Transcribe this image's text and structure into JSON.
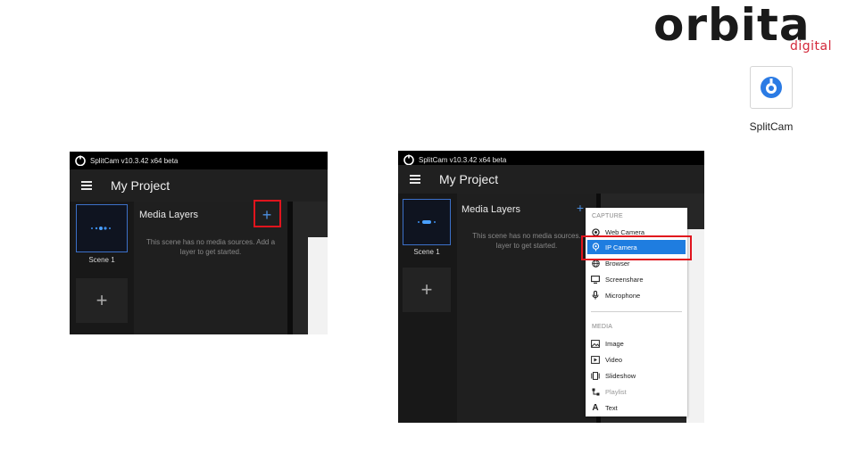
{
  "brand": {
    "name": "orbita",
    "sub": "digital",
    "accent_color": "#d3283a"
  },
  "desktop_icon": {
    "label": "SplitCam",
    "icon": "splitcam-icon"
  },
  "left_screenshot": {
    "window_title": "SplitCam v10.3.42 x64 beta",
    "project_title": "My Project",
    "scene_label": "Scene 1",
    "layers_title": "Media Layers",
    "empty_message_1": "This scene has no media sources. Add a",
    "empty_message_2": "layer to get started.",
    "add_layer_symbol": "+",
    "add_scene_symbol": "+"
  },
  "right_screenshot": {
    "window_title": "SplitCam v10.3.42 x64 beta",
    "project_title": "My Project",
    "scene_label": "Scene 1",
    "layers_title": "Media Layers",
    "empty_message_1": "This scene has no media sources.",
    "empty_message_2": "layer to get started.",
    "add_layer_symbol": "+",
    "add_scene_symbol": "+",
    "menu": {
      "capture_header": "CAPTURE",
      "capture_items": [
        {
          "label": "Web Camera",
          "icon": "webcam-icon"
        },
        {
          "label": "IP Camera",
          "icon": "ip-camera-icon",
          "active": true
        },
        {
          "label": "Browser",
          "icon": "globe-icon"
        },
        {
          "label": "Screenshare",
          "icon": "monitor-icon"
        },
        {
          "label": "Microphone",
          "icon": "microphone-icon"
        }
      ],
      "media_header": "MEDIA",
      "media_items": [
        {
          "label": "Image",
          "icon": "image-icon"
        },
        {
          "label": "Video",
          "icon": "video-icon"
        },
        {
          "label": "Slideshow",
          "icon": "slideshow-icon"
        },
        {
          "label": "Playlist",
          "icon": "playlist-icon",
          "disabled": true
        },
        {
          "label": "Text",
          "icon": "text-icon"
        }
      ]
    }
  },
  "colors": {
    "highlight": "#e0141d",
    "selection": "#1f7de0",
    "accent_blue": "#4c8fe0"
  }
}
